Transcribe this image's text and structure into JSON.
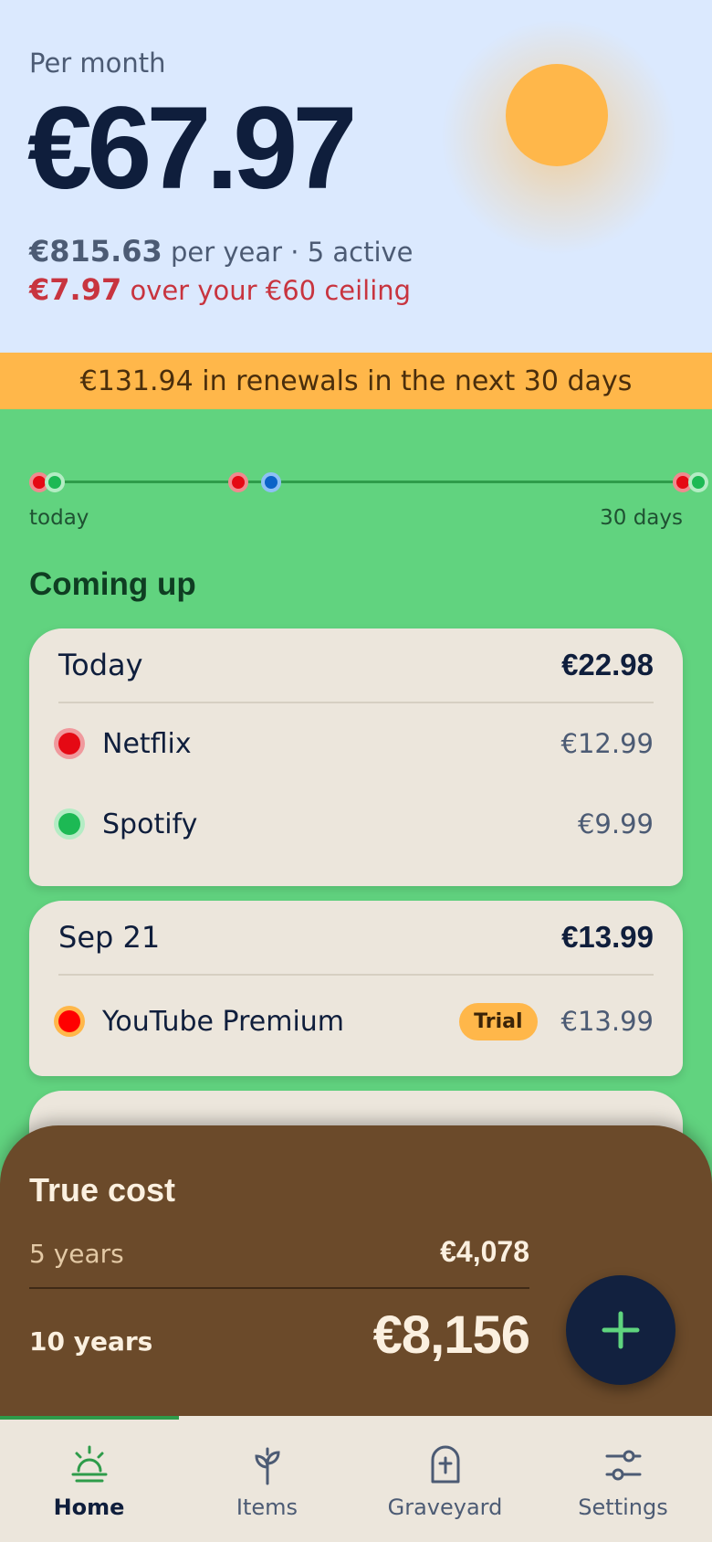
{
  "hero": {
    "per_month_label": "Per month",
    "monthly_amount": "€67.97",
    "yearly_amount": "€815.63",
    "yearly_suffix": "per year · 5 active",
    "over_amount": "€7.97",
    "over_suffix": "over your €60 ceiling"
  },
  "banner": {
    "text": "€131.94 in renewals in the next 30 days"
  },
  "timeline": {
    "start_label": "today",
    "end_label": "30 days"
  },
  "coming_up": {
    "title": "Coming up",
    "groups": [
      {
        "date": "Today",
        "total": "€22.98",
        "items": [
          {
            "name": "Netflix",
            "price": "€12.99",
            "color": "#e50914"
          },
          {
            "name": "Spotify",
            "price": "€9.99",
            "color": "#1db954"
          }
        ]
      },
      {
        "date": "Sep 21",
        "total": "€13.99",
        "items": [
          {
            "name": "YouTube Premium",
            "price": "€13.99",
            "badge": "Trial",
            "color": "#ff0000"
          }
        ]
      }
    ]
  },
  "true_cost": {
    "title": "True cost",
    "five_years_label": "5 years",
    "five_years_value": "€4,078",
    "ten_years_label": "10 years",
    "ten_years_value": "€8,156"
  },
  "fab": {
    "icon": "plus-icon"
  },
  "nav": {
    "items": [
      {
        "label": "Home",
        "icon": "sunrise-icon",
        "active": true
      },
      {
        "label": "Items",
        "icon": "sprout-icon",
        "active": false
      },
      {
        "label": "Graveyard",
        "icon": "tombstone-icon",
        "active": false
      },
      {
        "label": "Settings",
        "icon": "sliders-icon",
        "active": false
      }
    ]
  },
  "colors": {
    "accent_green": "#2e9c4a",
    "warning_red": "#c8343f",
    "banner_orange": "#ffb74a",
    "sheet_brown": "#6b4a2a"
  }
}
